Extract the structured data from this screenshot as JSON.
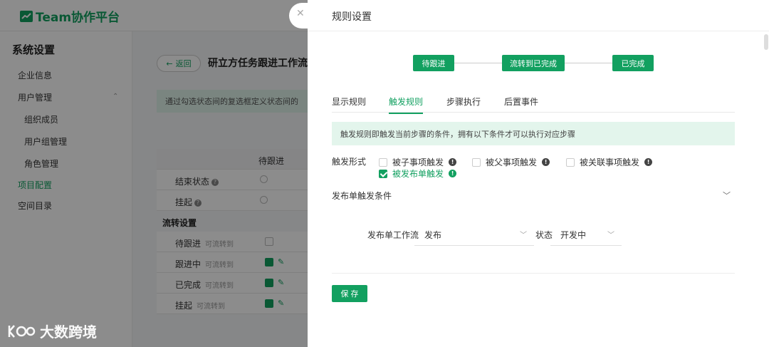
{
  "app": {
    "brand": "Team协作平台"
  },
  "sidebar": {
    "title": "系统设置",
    "items": [
      {
        "label": "企业信息"
      },
      {
        "label": "用户管理"
      },
      {
        "label": "组织成员"
      },
      {
        "label": "用户组管理"
      },
      {
        "label": "角色管理"
      },
      {
        "label": "项目配置"
      },
      {
        "label": "空间目录"
      }
    ]
  },
  "main": {
    "back_label": "返回",
    "page_title": "研立方任务跟进工作流",
    "notice": "通过勾选状态间的复选框定义状态间的",
    "table": {
      "column_header": "待跟进",
      "end_status": "结束状态",
      "suspend": "挂起",
      "flow_section": "流转设置",
      "flow_hint": "可流转到",
      "flow_rows": [
        "待跟进",
        "跟进中",
        "已完成",
        "挂起"
      ]
    }
  },
  "watermark": {
    "text": "大数跨境"
  },
  "drawer": {
    "title": "规则设置",
    "close_icon": "close-icon",
    "steps": [
      "待跟进",
      "流转到已完成",
      "已完成"
    ],
    "tabs": [
      "显示规则",
      "触发规则",
      "步骤执行",
      "后置事件"
    ],
    "active_tab": "触发规则",
    "info": "触发规则即触发当前步骤的条件，拥有以下条件才可以执行对应步骤",
    "trigger_label": "触发形式",
    "triggers": [
      {
        "label": "被子事项触发",
        "checked": false
      },
      {
        "label": "被父事项触发",
        "checked": false
      },
      {
        "label": "被关联事项触发",
        "checked": false
      },
      {
        "label": "被发布单触发",
        "checked": true
      }
    ],
    "condition_section": "发布单触发条件",
    "workflow_label": "发布单工作流",
    "workflow_value": "发布",
    "status_label": "状态",
    "status_value": "开发中",
    "save_label": "保 存"
  },
  "colors": {
    "accent": "#12a060",
    "info_bg": "#e3f5ec"
  }
}
